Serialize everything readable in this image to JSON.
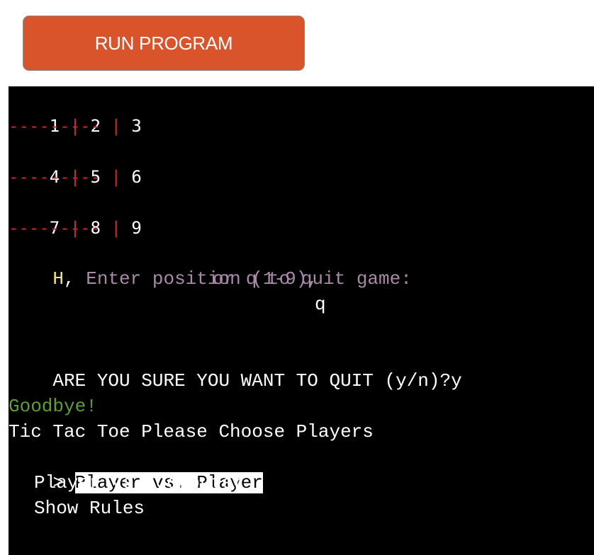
{
  "toolbar": {
    "run_label": "RUN PROGRAM"
  },
  "board": {
    "rows": [
      [
        "1",
        "2",
        "3"
      ],
      [
        "4",
        "5",
        "6"
      ],
      [
        "7",
        "8",
        "9"
      ]
    ],
    "cell_separator": "|",
    "row_separator": "---------"
  },
  "prompt": {
    "player": "H",
    "comma": ",",
    "line1": " Enter position (1-9),",
    "line2": "or q to quit game:",
    "input": "q"
  },
  "quit": {
    "question": "ARE YOU SURE YOU WANT TO QUIT (y/n)?",
    "answer": "y"
  },
  "goodbye": "Goodbye!",
  "menu": {
    "title": "Tic Tac Toe Please Choose Players",
    "cursor": ">",
    "items": [
      "Player vs. Player",
      "Player vs. Computer",
      "Show Rules"
    ],
    "selected_index": 0
  },
  "colors": {
    "button": "#d9532b",
    "separator": "#cc2a2a",
    "prompt_text": "#a88aa8",
    "player_h": "#f5e67a",
    "goodbye": "#5e9e35"
  }
}
